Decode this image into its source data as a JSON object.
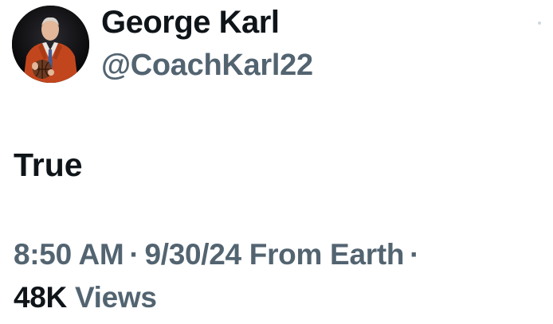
{
  "author": {
    "display_name": "George Karl",
    "handle": "@CoachKarl22",
    "avatar_icon": "profile-photo"
  },
  "tweet": {
    "text": "True"
  },
  "meta": {
    "time": "8:50 AM",
    "separator": "·",
    "date": "9/30/24",
    "source": "From Earth",
    "trailing_separator": "·"
  },
  "stats": {
    "views_count": "48K",
    "views_label": "Views"
  },
  "colors": {
    "primary_text": "#0f1419",
    "secondary_text": "#536471",
    "background": "#ffffff"
  }
}
